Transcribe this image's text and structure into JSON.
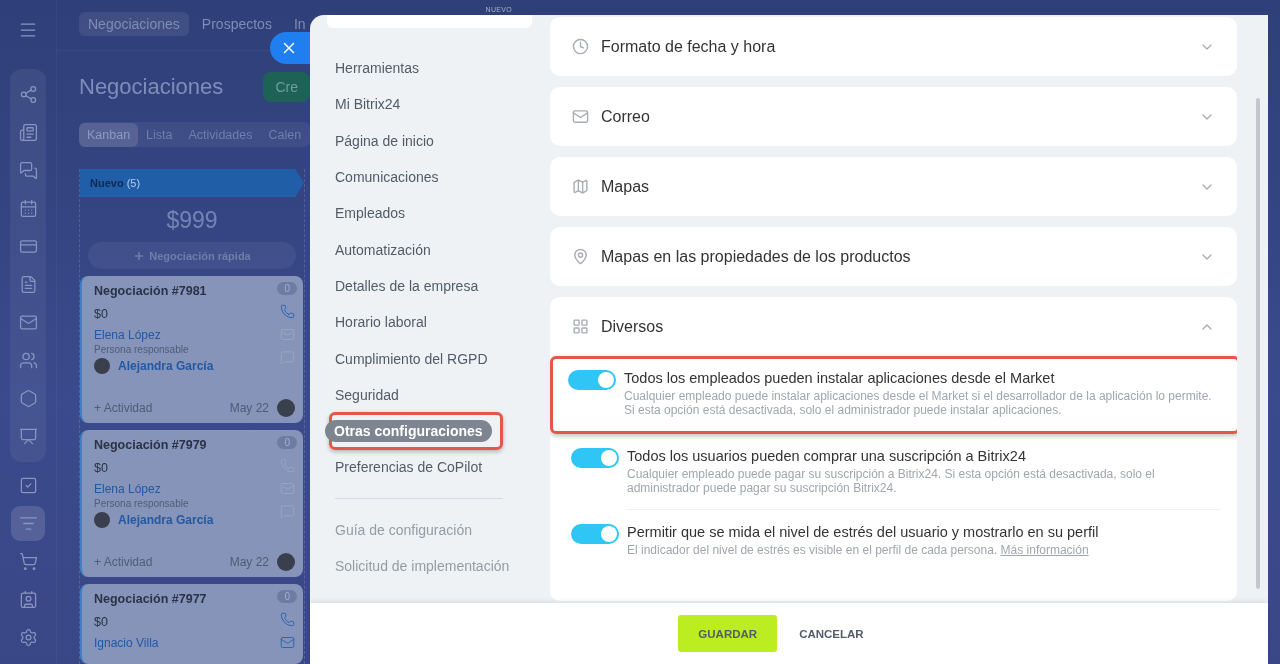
{
  "backdrop": {
    "nav": {
      "items": [
        {
          "selected": false
        },
        {
          "selected": false
        },
        {
          "selected": false
        },
        {
          "selected": false
        },
        {
          "selected": false
        },
        {
          "selected": false
        },
        {
          "selected": false
        },
        {
          "selected": false
        },
        {
          "selected": false
        },
        {
          "selected": false
        },
        {
          "selected": false
        },
        {
          "selected": true
        },
        {
          "selected": false
        },
        {
          "selected": false
        },
        {
          "selected": false
        }
      ]
    },
    "top_tabs": [
      {
        "label": "Negociaciones",
        "selected": true
      },
      {
        "label": "Prospectos",
        "selected": false
      },
      {
        "label": "In",
        "selected": false
      }
    ],
    "title": "Negociaciones",
    "create_button": "Cre",
    "view_tabs": [
      {
        "label": "Kanban",
        "selected": true
      },
      {
        "label": "Lista",
        "selected": false
      },
      {
        "label": "Actividades",
        "selected": false
      },
      {
        "label": "Calen",
        "selected": false
      }
    ],
    "column": {
      "name": "Nuevo",
      "count": "(5)",
      "total": "$999",
      "quick_add": "Negociación rápida"
    },
    "cards": [
      {
        "title": "Negociación #7981",
        "amount": "$0",
        "badge": "0",
        "contact": "Elena López",
        "role": "Persona responsable",
        "responsible": "Alejandra García",
        "activity": "+ Actividad",
        "date": "May 22",
        "phone_active": true,
        "mail_active": false
      },
      {
        "title": "Negociación #7979",
        "amount": "$0",
        "badge": "0",
        "contact": "Elena López",
        "role": "Persona responsable",
        "responsible": "Alejandra García",
        "activity": "+ Actividad",
        "date": "May 22",
        "phone_active": false,
        "mail_active": false
      },
      {
        "title": "Negociación #7977",
        "amount": "$0",
        "badge": "0",
        "contact": "Ignacio Villa",
        "phone_active": true,
        "mail_active": true
      }
    ]
  },
  "settings": {
    "search": {
      "badge": "NUEVO"
    },
    "menu": [
      {
        "label": "Herramientas",
        "selected": false,
        "highlighted": false
      },
      {
        "label": "Mi Bitrix24",
        "selected": false,
        "highlighted": false
      },
      {
        "label": "Página de inicio",
        "selected": false,
        "highlighted": false
      },
      {
        "label": "Comunicaciones",
        "selected": false,
        "highlighted": false
      },
      {
        "label": "Empleados",
        "selected": false,
        "highlighted": false
      },
      {
        "label": "Automatización",
        "selected": false,
        "highlighted": false
      },
      {
        "label": "Detalles de la empresa",
        "selected": false,
        "highlighted": false
      },
      {
        "label": "Horario laboral",
        "selected": false,
        "highlighted": false
      },
      {
        "label": "Cumplimiento del RGPD",
        "selected": false,
        "highlighted": false
      },
      {
        "label": "Seguridad",
        "selected": false,
        "highlighted": false
      },
      {
        "label": "Otras configuraciones",
        "selected": true,
        "highlighted": true
      },
      {
        "label": "Preferencias de CoPilot",
        "selected": false,
        "highlighted": false
      }
    ],
    "secondary_menu": [
      {
        "label": "Guía de configuración"
      },
      {
        "label": "Solicitud de implementación"
      }
    ],
    "sections": [
      {
        "title": "Formato de fecha y hora",
        "expanded": false
      },
      {
        "title": "Correo",
        "expanded": false
      },
      {
        "title": "Mapas",
        "expanded": false
      },
      {
        "title": "Mapas en las propiedades de los productos",
        "expanded": false
      },
      {
        "title": "Diversos",
        "expanded": true,
        "options": [
          {
            "title": "Todos los empleados pueden instalar aplicaciones desde el Market",
            "description": "Cualquier empleado puede instalar aplicaciones desde el Market si el desarrollador de la aplicación lo permite. Si esta opción está desactivada, solo el administrador puede instalar aplicaciones.",
            "on": true,
            "highlighted": true
          },
          {
            "title": "Todos los usuarios pueden comprar una suscripción a Bitrix24",
            "description": "Cualquier empleado puede pagar su suscripción a Bitrix24. Si esta opción está desactivada, solo el administrador puede pagar su suscripción Bitrix24.",
            "on": true,
            "highlighted": false
          },
          {
            "title": "Permitir que se mida el nivel de estrés del usuario y mostrarlo en su perfil",
            "description": "El indicador del nivel de estrés es visible en el perfil de cada persona.",
            "link": "Más información",
            "on": true,
            "highlighted": false
          }
        ]
      }
    ],
    "footer": {
      "save": "GUARDAR",
      "cancel": "CANCELAR"
    }
  }
}
